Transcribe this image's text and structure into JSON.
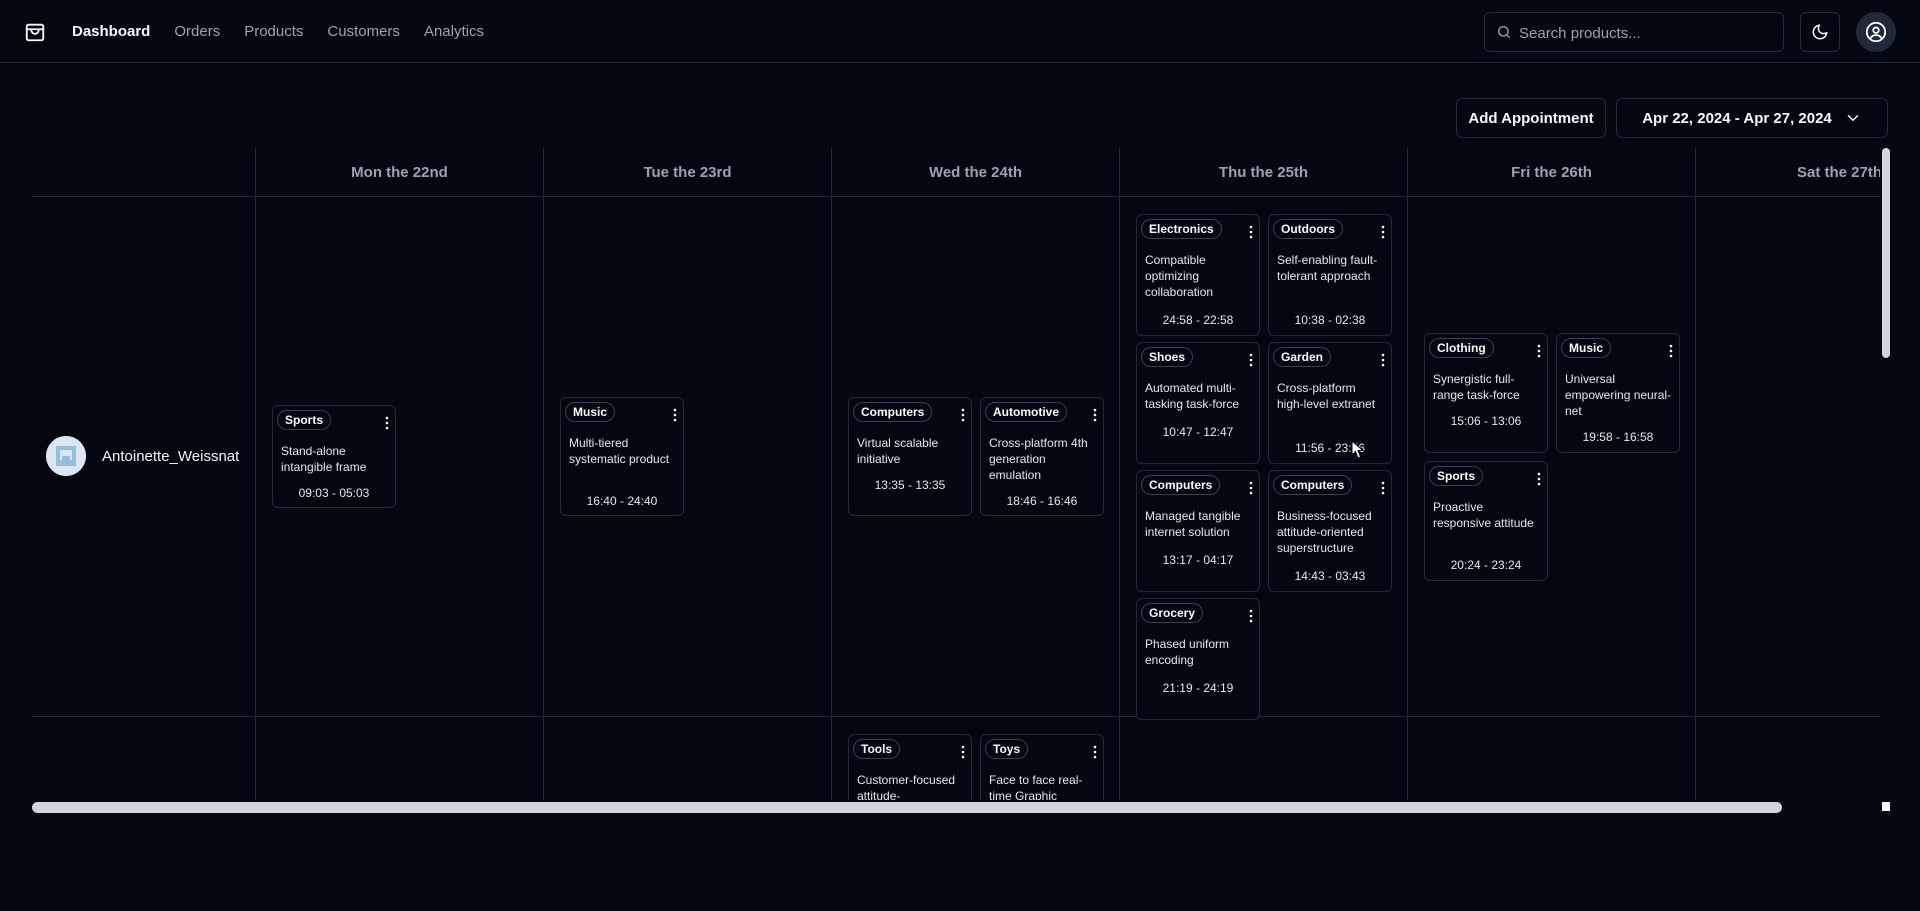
{
  "nav": {
    "links": [
      "Dashboard",
      "Orders",
      "Products",
      "Customers",
      "Analytics"
    ],
    "active": "Dashboard"
  },
  "search": {
    "placeholder": "Search products..."
  },
  "toolbar": {
    "add_label": "Add Appointment",
    "date_range": "Apr 22, 2024 - Apr 27, 2024"
  },
  "days": [
    "Mon the 22nd",
    "Tue the 23rd",
    "Wed the 24th",
    "Thu the 25th",
    "Fri the 26th",
    "Sat the 27th"
  ],
  "resource": {
    "name": "Antoinette_Weissnat"
  },
  "appointments": [
    {
      "category": "Sports",
      "title": "Stand-alone intangible frame",
      "time": "09:03 - 05:03"
    },
    {
      "category": "Music",
      "title": "Multi-tiered systematic product",
      "time": "16:40 - 24:40"
    },
    {
      "category": "Computers",
      "title": "Virtual scalable initiative",
      "time": "13:35 - 13:35"
    },
    {
      "category": "Automotive",
      "title": "Cross-platform 4th generation emulation",
      "time": "18:46 - 16:46"
    },
    {
      "category": "Electronics",
      "title": "Compatible optimizing collaboration",
      "time": "24:58 - 22:58"
    },
    {
      "category": "Outdoors",
      "title": "Self-enabling fault-tolerant approach",
      "time": "10:38 - 02:38"
    },
    {
      "category": "Shoes",
      "title": "Automated multi-tasking task-force",
      "time": "10:47 - 12:47"
    },
    {
      "category": "Garden",
      "title": "Cross-platform high-level extranet",
      "time": "11:56 - 23:56"
    },
    {
      "category": "Computers",
      "title": "Managed tangible internet solution",
      "time": "13:17 - 04:17"
    },
    {
      "category": "Computers",
      "title": "Business-focused attitude-oriented superstructure",
      "time": "14:43 - 03:43"
    },
    {
      "category": "Grocery",
      "title": "Phased uniform encoding",
      "time": "21:19 - 24:19"
    },
    {
      "category": "Clothing",
      "title": "Synergistic full-range task-force",
      "time": "15:06 - 13:06"
    },
    {
      "category": "Music",
      "title": "Universal empowering neural-net",
      "time": "19:58 - 16:58"
    },
    {
      "category": "Sports",
      "title": "Proactive responsive attitude",
      "time": "20:24 - 23:24"
    },
    {
      "category": "Tools",
      "title": "Customer-focused attitude-",
      "time": ""
    },
    {
      "category": "Toys",
      "title": "Face to face real-time Graphic",
      "time": ""
    }
  ]
}
